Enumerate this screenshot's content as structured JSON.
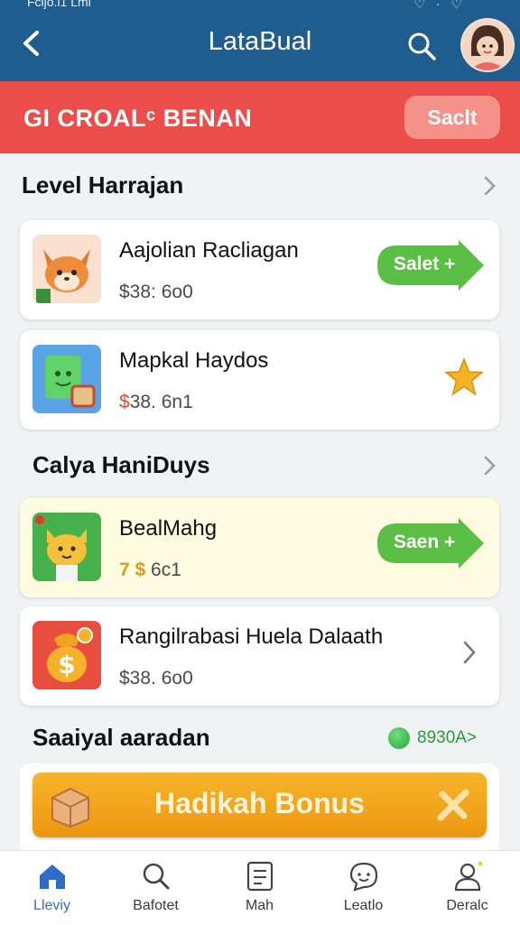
{
  "status_bar": {
    "left": "Fcijo.i1 Lmi",
    "right": "♡ · ♡"
  },
  "header": {
    "title": "LataBual",
    "back_icon": "chevron-left-icon",
    "search_icon": "search-icon",
    "avatar_icon": "avatar-icon"
  },
  "banner": {
    "title": "GI CROALᶜ BENAN",
    "button_label": "Saclt",
    "color": "#ea4d4a"
  },
  "sections": [
    {
      "title": "Level Harrajan"
    },
    {
      "title": "Calya HaniDuys"
    },
    {
      "title": "Saaiyal aaradan",
      "count": "8930A>"
    }
  ],
  "cards": [
    {
      "name": "Aajolian Racliagan",
      "price": "$38: 6o0",
      "action": "Salet +",
      "icon": "fox-icon"
    },
    {
      "name": "Mapkal Haydos",
      "price_prefix": "$",
      "price_rest": "38. 6n1",
      "icon": "green-box-icon",
      "badge_icon": "star-icon"
    },
    {
      "name": "BealMahg",
      "price_prefix": "7 $",
      "price_rest": " 6c1",
      "action": "Saen +",
      "icon": "cat-icon"
    },
    {
      "name": "Rangilrabasi Huela Dalaath",
      "price": "$38. 6o0",
      "icon": "coin-bag-icon"
    }
  ],
  "bonus": {
    "label": "Hadikah Bonus"
  },
  "nav": [
    {
      "label": "Lleviy",
      "icon": "home-icon",
      "active": true
    },
    {
      "label": "Bafotet",
      "icon": "search-icon",
      "active": false
    },
    {
      "label": "Mah",
      "icon": "list-icon",
      "active": false
    },
    {
      "label": "Leatlo",
      "icon": "chat-icon",
      "active": false
    },
    {
      "label": "Deralc",
      "icon": "profile-icon",
      "active": false
    }
  ],
  "colors": {
    "header": "#1f5d8e",
    "green": "#5cbf45",
    "bonus": "#f2a51c",
    "active_nav": "#2f6cc7"
  }
}
